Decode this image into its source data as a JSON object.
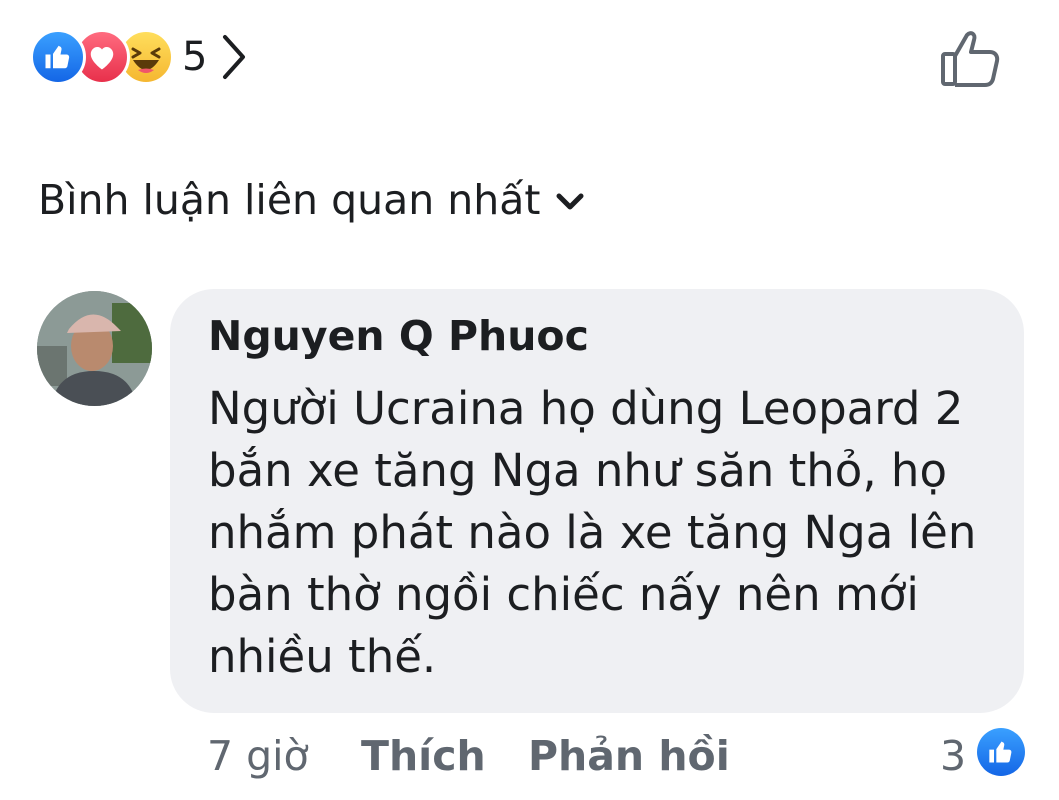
{
  "reactions": {
    "icons": [
      "like-icon",
      "love-icon",
      "haha-icon"
    ],
    "count": "5"
  },
  "sort": {
    "label": "Bình luận liên quan nhất"
  },
  "comment": {
    "author": "Nguyen Q Phuoc",
    "lines": [
      "Người Ucraina họ dùng Leopard 2",
      "bắn xe tăng Nga như săn thỏ, họ",
      "nhắm phát nào là xe tăng Nga lên",
      "bàn thờ ngồi chiếc nấy nên mới",
      "nhiều thế."
    ],
    "time": "7 giờ",
    "like_label": "Thích",
    "reply_label": "Phản hồi",
    "like_count": "3"
  },
  "colors": {
    "like_blue": "#1877f2",
    "love_red": "#f33e58",
    "haha_yellow": "#f7b125",
    "bubble_bg": "#eff0f3"
  }
}
